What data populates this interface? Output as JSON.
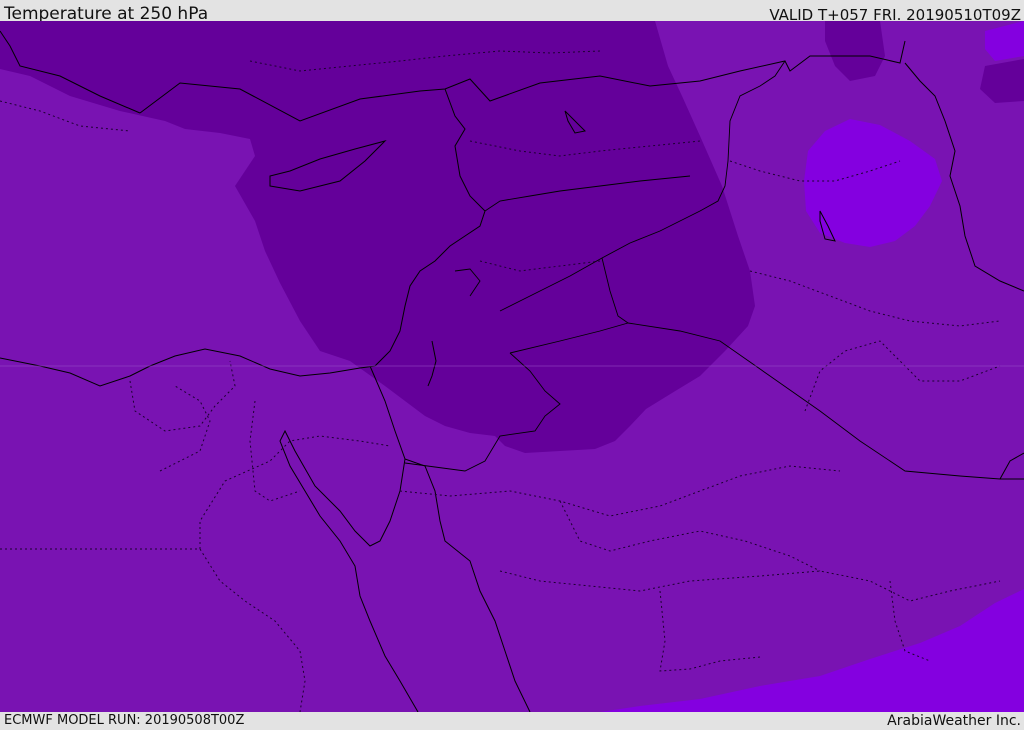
{
  "header": {
    "title": "Temperature at 250 hPa",
    "valid_time": "VALID T+057 FRI. 20190510T09Z"
  },
  "footer": {
    "model_run": "ECMWF MODEL RUN: 20190508T00Z",
    "credit": "ArabiaWeather Inc."
  },
  "colors": {
    "background_band": "#7913b2",
    "cold_band": "#64009a",
    "warm_band": "#8400e0",
    "coastline": "#000000",
    "chrome": "#e3e3e3"
  }
}
